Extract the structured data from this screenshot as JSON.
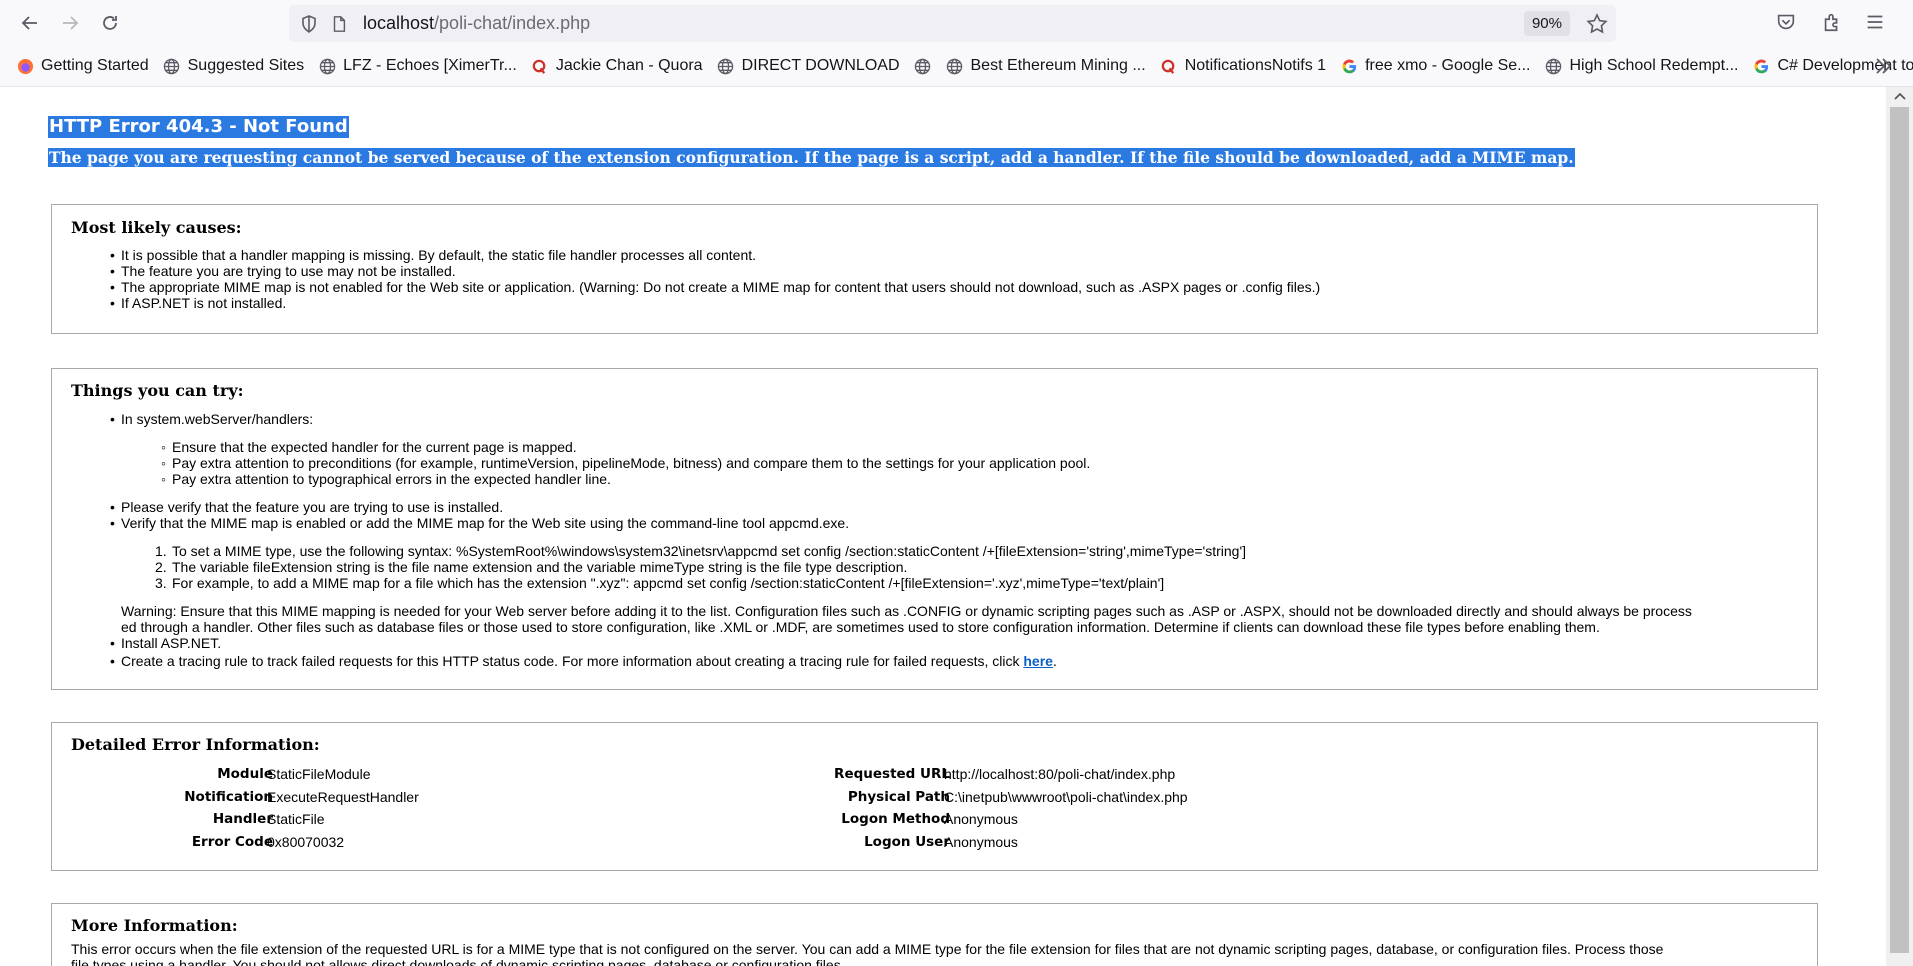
{
  "browser": {
    "url_host": "localhost",
    "url_path": "/poli-chat/index.php",
    "zoom": "90%"
  },
  "bookmarks": [
    {
      "label": "Getting Started",
      "icon": "firefox-icon"
    },
    {
      "label": "Suggested Sites",
      "icon": "globe-icon"
    },
    {
      "label": "LFZ - Echoes [XimerTr...",
      "icon": "globe-icon"
    },
    {
      "label": "Jackie Chan - Quora",
      "icon": "quora-icon"
    },
    {
      "label": "DIRECT DOWNLOAD",
      "icon": "globe-icon"
    },
    {
      "label": "",
      "icon": "globe-icon"
    },
    {
      "label": "Best Ethereum Mining ...",
      "icon": "globe-icon"
    },
    {
      "label": "NotificationsNotifs 1",
      "icon": "quora-icon"
    },
    {
      "label": "free xmo - Google Se...",
      "icon": "google-icon"
    },
    {
      "label": "High School Redempt...",
      "icon": "globe-icon"
    },
    {
      "label": "C# Development tools...",
      "icon": "google-icon"
    }
  ],
  "error": {
    "title": "HTTP Error 404.3 - Not Found",
    "subtitle": "The page you are requesting cannot be served because of the extension configuration. If the page is a script, add a handler. If the file should be downloaded, add a MIME map."
  },
  "causes": {
    "heading": "Most likely causes:",
    "items": [
      "It is possible that a handler mapping is missing. By default, the static file handler processes all content.",
      "The feature you are trying to use may not be installed.",
      "The appropriate MIME map is not enabled for the Web site or application. (Warning: Do not create a MIME map for content that users should not download, such as .ASPX pages or .config files.)",
      "If ASP.NET is not installed."
    ]
  },
  "try": {
    "heading": "Things you can try:",
    "handlers_intro": "In system.webServer/handlers:",
    "handlers_sub": [
      "Ensure that the expected handler for the current page is mapped.",
      "Pay extra attention to preconditions (for example, runtimeVersion, pipelineMode, bitness) and compare them to the settings for your application pool.",
      "Pay extra attention to typographical errors in the expected handler line."
    ],
    "verify_installed": "Please verify that the feature you are trying to use is installed.",
    "verify_mime": "Verify that the MIME map is enabled or add the MIME map for the Web site using the command-line tool appcmd.exe.",
    "steps": [
      "To set a MIME type, use the following syntax: %SystemRoot%\\windows\\system32\\inetsrv\\appcmd set config /section:staticContent /+[fileExtension='string',mimeType='string']",
      "The variable fileExtension string is the file name extension and the variable mimeType string is the file type description.",
      "For example, to add a MIME map for a file which has the extension \".xyz\": appcmd set config /section:staticContent /+[fileExtension='.xyz',mimeType='text/plain']"
    ],
    "warning_line1": "Warning: Ensure that this MIME mapping is needed for your Web server before adding it to the list. Configuration files such as .CONFIG or dynamic scripting pages such as .ASP or .ASPX, should not be downloaded directly and should always be process",
    "warning_line2": "ed through a handler. Other files such as database files or those used to store configuration, like .XML or .MDF, are sometimes used to store configuration information. Determine if clients can download these file types before enabling them.",
    "install_aspnet": "Install ASP.NET.",
    "tracing_text": "Create a tracing rule to track failed requests for this HTTP status code. For more information about creating a tracing rule for failed requests, click ",
    "tracing_link": "here",
    "tracing_end": "."
  },
  "details": {
    "heading": "Detailed Error Information:",
    "left": [
      {
        "label": "Module",
        "value": "StaticFileModule"
      },
      {
        "label": "Notification",
        "value": "ExecuteRequestHandler"
      },
      {
        "label": "Handler",
        "value": "StaticFile"
      },
      {
        "label": "Error Code",
        "value": "0x80070032"
      }
    ],
    "right": [
      {
        "label": "Requested URL",
        "value": "http://localhost:80/poli-chat/index.php"
      },
      {
        "label": "Physical Path",
        "value": "C:\\inetpub\\wwwroot\\poli-chat\\index.php"
      },
      {
        "label": "Logon Method",
        "value": "Anonymous"
      },
      {
        "label": "Logon User",
        "value": "Anonymous"
      }
    ]
  },
  "more": {
    "heading": "More Information:",
    "line1": "This error occurs when the file extension of the requested URL is for a MIME type that is not configured on the server. You can add a MIME type for the file extension for files that are not dynamic scripting pages, database, or configuration files. Process those",
    "line2": "file types using a handler. You should not allows direct downloads of dynamic scripting pages, database or configuration files."
  }
}
